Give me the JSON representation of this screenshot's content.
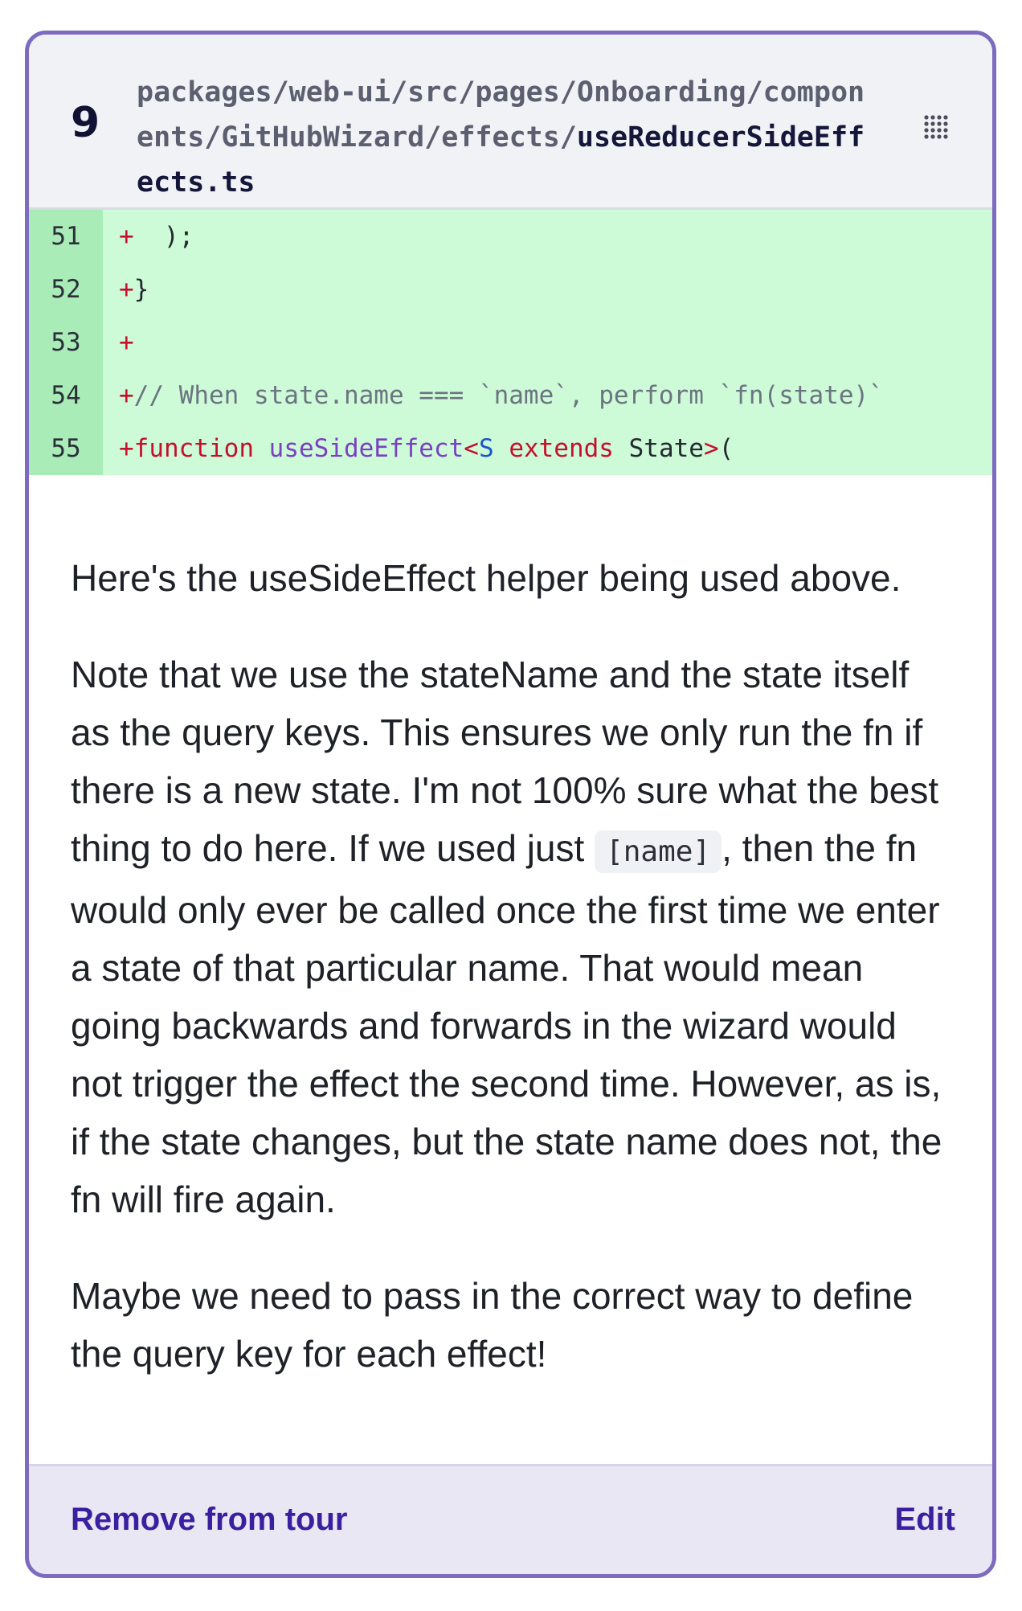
{
  "step": {
    "number": "9",
    "path_prefix": "packages/web-ui/src/pages/Onboarding/components/GitHubWizard/effects/",
    "file_name": "useReducerSideEffects.ts"
  },
  "code": {
    "lines": [
      {
        "num": "51",
        "plus": "+",
        "text": "  );"
      },
      {
        "num": "52",
        "plus": "+",
        "text": "}"
      },
      {
        "num": "53",
        "plus": "+",
        "text": ""
      },
      {
        "num": "54",
        "plus": "+",
        "comment": "// When state.name === `name`, perform `fn(state)`"
      },
      {
        "num": "55",
        "plus": "+",
        "kw1": "function",
        "fn": "useSideEffect",
        "lt": "<",
        "type": "S",
        "kw2": "extends",
        "state": "State",
        "gt": ">",
        "paren": "("
      }
    ]
  },
  "body": {
    "p1": "Here's the useSideEffect helper being used above.",
    "p2_before": "Note that we use the stateName and the state itself as the query keys. This ensures we only run the fn if there is a new state. I'm not 100% sure what the best thing to do here. If we used just ",
    "p2_code": "[name]",
    "p2_after": ", then the fn would only ever be called once the first time we enter a state of that particular name. That would mean going backwards and forwards in the wizard would not trigger the effect the second time. However, as is, if the state changes, but the state name does not, the fn will fire again.",
    "p3": "Maybe we need to pass in the correct way to define the query key for each effect!"
  },
  "footer": {
    "remove_label": "Remove from tour",
    "edit_label": "Edit"
  },
  "colors": {
    "border": "#7c6bbf",
    "added_line_bg": "#cdfbd8",
    "added_gutter_bg": "#a9ecb7",
    "link": "#3a1fa0"
  },
  "icons": {
    "drag": "drag-handle-icon"
  }
}
